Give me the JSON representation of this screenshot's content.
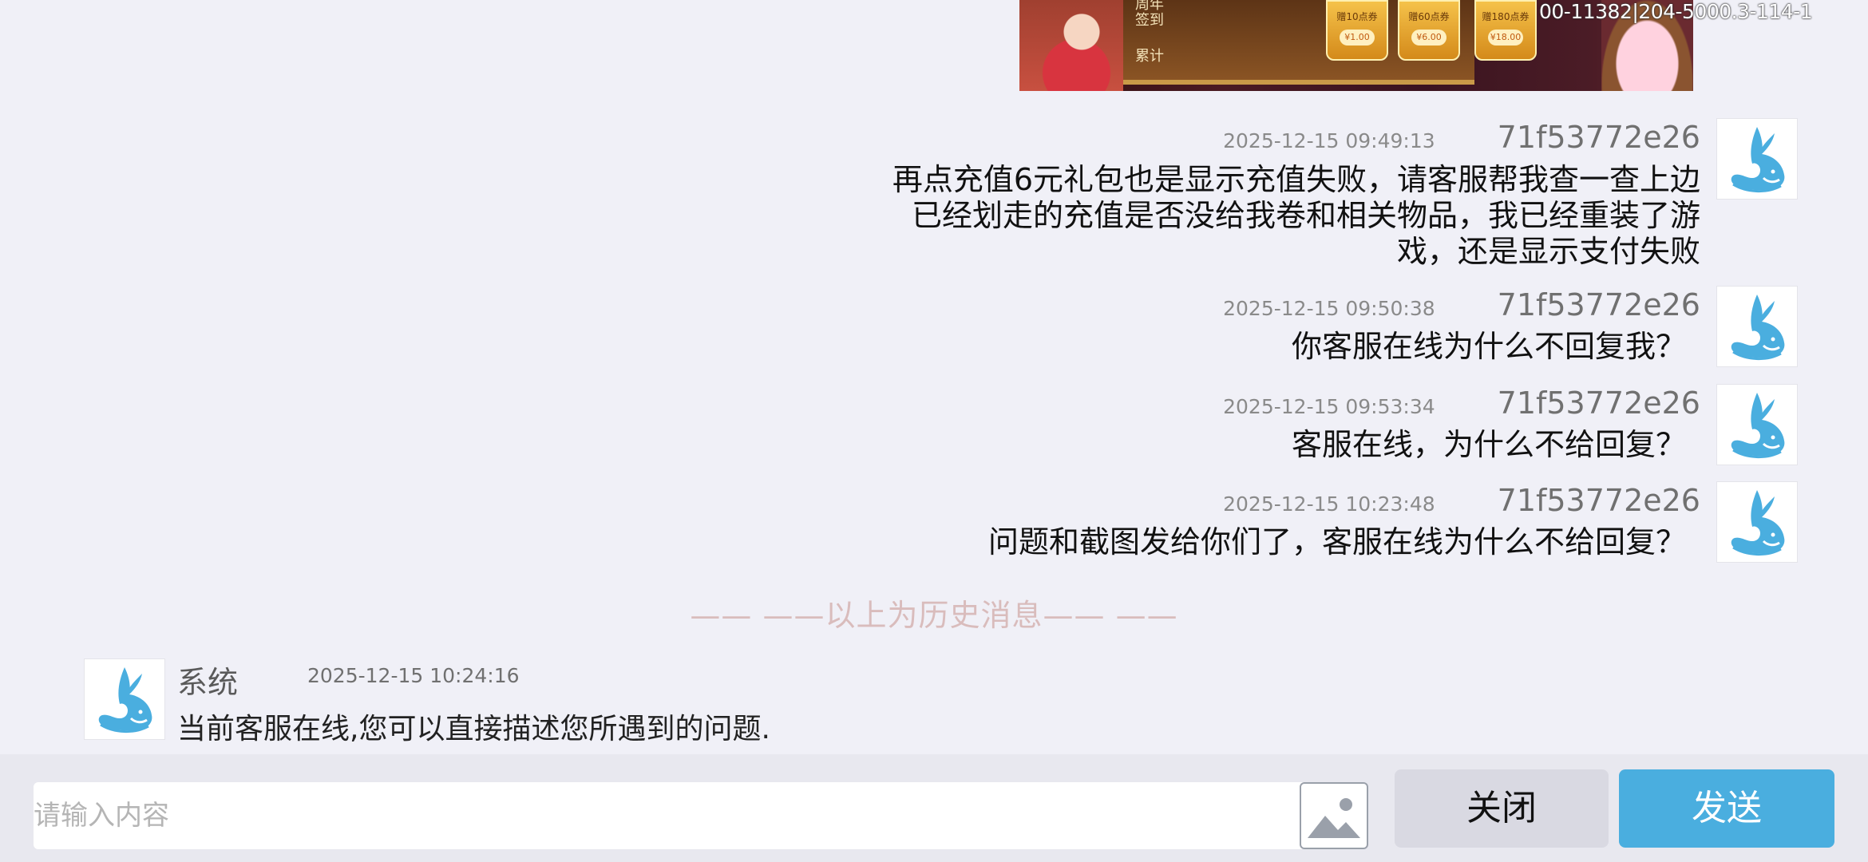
{
  "banner": {
    "code_text": "00-11382|204-5000.3-114-1",
    "label_top": "周年\n签到",
    "label_bottom": "累计",
    "coupons": [
      {
        "label": "赠10点券",
        "price": "¥1.00"
      },
      {
        "label": "赠60点券",
        "price": "¥6.00"
      },
      {
        "label": "赠180点券",
        "price": "¥18.00"
      }
    ]
  },
  "messages": [
    {
      "time": "2025-12-15 09:49:13",
      "user": "71f53772e26",
      "text": "再点充值6元礼包也是显示充值失败，请客服帮我查一查上边\n已经划走的充值是否没给我卷和相关物品，我已经重装了游\n戏，还是显示支付失败"
    },
    {
      "time": "2025-12-15 09:50:38",
      "user": "71f53772e26",
      "text": "你客服在线为什么不回复我？"
    },
    {
      "time": "2025-12-15 09:53:34",
      "user": "71f53772e26",
      "text": "客服在线，为什么不给回复？"
    },
    {
      "time": "2025-12-15 10:23:48",
      "user": "71f53772e26",
      "text": "问题和截图发给你们了，客服在线为什么不给回复？"
    }
  ],
  "history_divider": "——  ——以上为历史消息——  ——",
  "system_message": {
    "name": "系统",
    "time": "2025-12-15 10:24:16",
    "text": "当前客服在线,您可以直接描述您所遇到的问题."
  },
  "input": {
    "placeholder": "请输入内容"
  },
  "buttons": {
    "close": "关闭",
    "send": "发送"
  },
  "colors": {
    "background": "#f0f0f7",
    "send_button": "#4aaedf",
    "close_button": "#d9d9e2",
    "whale_avatar": "#4aaedf",
    "divider_text": "#d9bcbc"
  }
}
